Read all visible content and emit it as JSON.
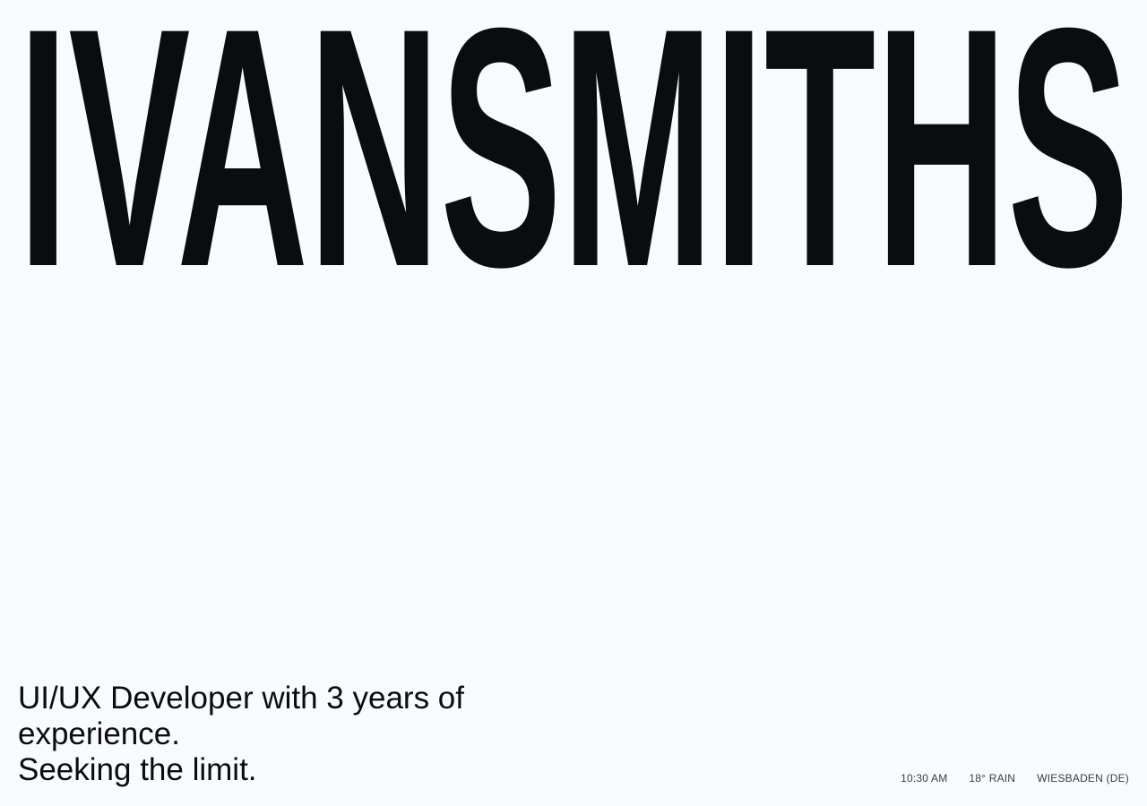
{
  "hero": {
    "name": "IVANSMITHS"
  },
  "intro": {
    "line1": "UI/UX Developer with 3 years of",
    "line2": "experience.",
    "line3": "Seeking the limit."
  },
  "status": {
    "time": "10:30 AM",
    "weather": "18° RAIN",
    "location": "WIESBADEN (DE)"
  },
  "colors": {
    "background": "#f8fafc",
    "text": "#0b0c0e"
  }
}
